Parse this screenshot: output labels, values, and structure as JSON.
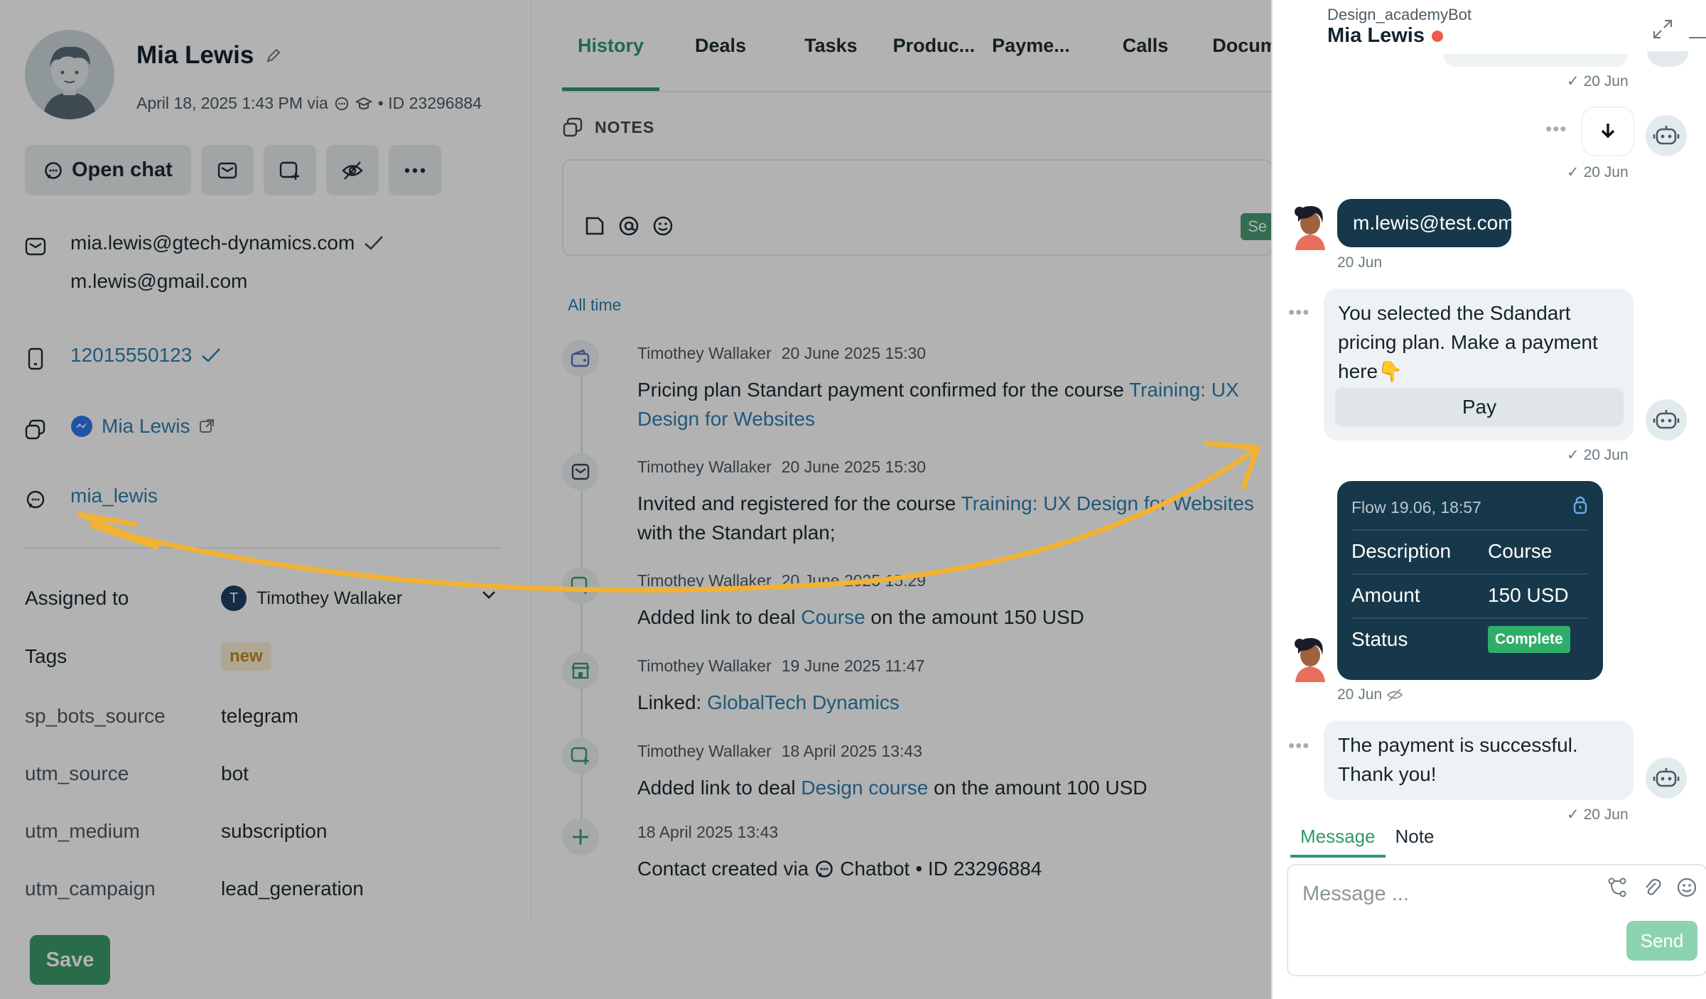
{
  "contact": {
    "name": "Mia Lewis",
    "meta_date": "April 18, 2025 1:43 PM via",
    "meta_id": "• ID 23296884",
    "open_chat_label": "Open chat",
    "emails": [
      "mia.lewis@gtech-dynamics.com",
      "m.lewis@gmail.com"
    ],
    "phone": "12015550123",
    "messenger_name": "Mia Lewis",
    "username": "mia_lewis"
  },
  "fields": {
    "assigned_label": "Assigned to",
    "assigned_initial": "T",
    "assigned_value": "Timothey Wallaker",
    "tags_label": "Tags",
    "tag_value": "new",
    "rows": [
      {
        "label": "sp_bots_source",
        "value": "telegram"
      },
      {
        "label": "utm_source",
        "value": "bot"
      },
      {
        "label": "utm_medium",
        "value": "subscription"
      },
      {
        "label": "utm_campaign",
        "value": "lead_generation"
      }
    ]
  },
  "save_bar": {
    "save_label": "Save"
  },
  "tabs": [
    "History",
    "Deals",
    "Tasks",
    "Produc...",
    "Payme...",
    "Calls",
    "Docum"
  ],
  "notes": {
    "label": "NOTES",
    "save_partial": "Se"
  },
  "filter": {
    "label": "All time"
  },
  "timeline": [
    {
      "author": "Timothey Wallaker",
      "date": "20 June 2025 15:30",
      "text": "Pricing plan Standart payment confirmed for the course ",
      "link": "Training: UX Design for Websites",
      "tail": ""
    },
    {
      "author": "Timothey Wallaker",
      "date": "20 June 2025 15:30",
      "text": "Invited and registered for the course ",
      "link": "Training: UX Design for Websites",
      "tail": " with the Standart plan;"
    },
    {
      "author": "Timothey Wallaker",
      "date": "20 June 2025 15:29",
      "text": "Added link to deal ",
      "link": "Course",
      "tail": " on the amount 150 USD"
    },
    {
      "author": "Timothey Wallaker",
      "date": "19 June 2025 11:47",
      "text": "Linked: ",
      "link": "GlobalTech Dynamics",
      "tail": ""
    },
    {
      "author": "Timothey Wallaker",
      "date": "18 April 2025 13:43",
      "text": "Added link to deal ",
      "link": "Design course",
      "tail": " on the amount 100 USD"
    },
    {
      "author": "",
      "date": "18 April 2025 13:43",
      "text": "Contact created via ",
      "link": "",
      "tail": "Chatbot",
      "id": "• ID 23296884"
    }
  ],
  "chat": {
    "bot_name": "Design_academyBot",
    "user_name": "Mia Lewis",
    "ts_1": "20 Jun",
    "ts_2": "20 Jun",
    "user_email_msg": "m.lewis@test.com",
    "ts_3": "20 Jun",
    "bot_msg_1": "You selected the Sdandart pricing plan. Make a payment here👇",
    "pay_label": "Pay",
    "ts_4": "20 Jun",
    "flow_title": "Flow 19.06, 18:57",
    "flow_rows": [
      {
        "k": "Description",
        "v": "Course"
      },
      {
        "k": "Amount",
        "v": "150 USD"
      },
      {
        "k": "Status",
        "v": "Complete"
      }
    ],
    "ts_5": "20 Jun",
    "bot_msg_2": "The payment is successful. Thank you!",
    "ts_6": "20 Jun",
    "tab_message": "Message",
    "tab_note": "Note",
    "placeholder": "Message ...",
    "send_label": "Send"
  },
  "colors": {
    "accent": "#2e9a68",
    "link": "#2f7fb0",
    "chat_bubble_dark": "#17384a",
    "arrow": "#f2b233"
  }
}
